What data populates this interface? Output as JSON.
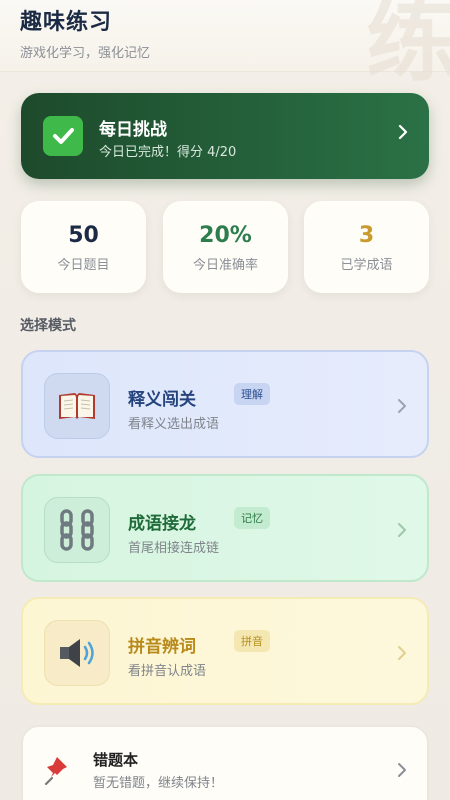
{
  "header": {
    "title": "趣味练习",
    "subtitle": "游戏化学习，强化记忆"
  },
  "daily_challenge": {
    "title": "每日挑战",
    "status": "今日已完成！得分 4/20",
    "icon": "check-icon"
  },
  "stats": [
    {
      "value": "50",
      "label": "今日题目",
      "color": "#1c2b45"
    },
    {
      "value": "20%",
      "label": "今日准确率",
      "color": "#2e7d4f"
    },
    {
      "value": "3",
      "label": "已学成语",
      "color": "#c99a2e"
    }
  ],
  "section_title": "选择模式",
  "modes": [
    {
      "name": "释义闯关",
      "tag": "理解",
      "desc": "看释义选出成语",
      "icon": "book-icon"
    },
    {
      "name": "成语接龙",
      "tag": "记忆",
      "desc": "首尾相接连成链",
      "icon": "chain-icon"
    },
    {
      "name": "拼音辨词",
      "tag": "拼音",
      "desc": "看拼音认成语",
      "icon": "speaker-icon"
    }
  ],
  "wrong_book": {
    "title": "错题本",
    "desc": "暂无错题，继续保持！",
    "icon": "pushpin-icon"
  },
  "colors": {
    "challenge_bg": "#24603a",
    "accent_blue": "#25447e",
    "accent_green": "#1f6b3a",
    "accent_gold": "#b88a1a"
  },
  "watermark": "练"
}
